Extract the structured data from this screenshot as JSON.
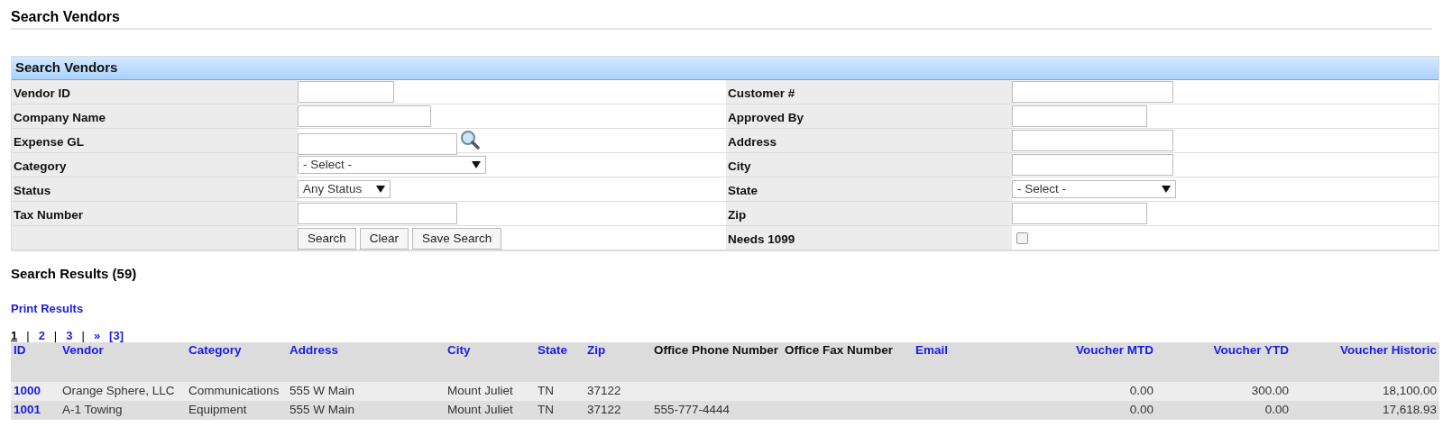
{
  "page_title": "Search Vendors",
  "search_panel": {
    "title": "Search Vendors",
    "left_fields": [
      {
        "label": "Vendor ID",
        "kind": "text"
      },
      {
        "label": "Company Name",
        "kind": "text"
      },
      {
        "label": "Expense GL",
        "kind": "lookup"
      },
      {
        "label": "Category",
        "kind": "select",
        "value": "- Select -"
      },
      {
        "label": "Status",
        "kind": "select",
        "value": "Any Status"
      },
      {
        "label": "Tax Number",
        "kind": "text"
      }
    ],
    "right_fields": [
      {
        "label": "Customer #",
        "kind": "text"
      },
      {
        "label": "Approved By",
        "kind": "text"
      },
      {
        "label": "Address",
        "kind": "text"
      },
      {
        "label": "City",
        "kind": "text"
      },
      {
        "label": "State",
        "kind": "select",
        "value": "- Select -"
      },
      {
        "label": "Zip",
        "kind": "text"
      },
      {
        "label": "Needs 1099",
        "kind": "checkbox",
        "checked": false
      }
    ],
    "buttons": [
      "Search",
      "Clear",
      "Save Search"
    ]
  },
  "results": {
    "title": "Search Results (59)",
    "print_link": "Print Results",
    "pagination": [
      {
        "label": "1",
        "kind": "current"
      },
      {
        "label": "|",
        "kind": "separator"
      },
      {
        "label": "2",
        "kind": "page"
      },
      {
        "label": "|",
        "kind": "separator"
      },
      {
        "label": "3",
        "kind": "page"
      },
      {
        "label": "|",
        "kind": "separator"
      },
      {
        "label": "»",
        "kind": "page"
      },
      {
        "label": "[3]",
        "kind": "page"
      }
    ],
    "columns": [
      {
        "label": "ID",
        "kind": "id",
        "sortable": true
      },
      {
        "label": "Vendor",
        "kind": "text",
        "sortable": true
      },
      {
        "label": "Category",
        "kind": "text",
        "sortable": true
      },
      {
        "label": "Address",
        "kind": "text",
        "sortable": true
      },
      {
        "label": "City",
        "kind": "text",
        "sortable": true
      },
      {
        "label": "State",
        "kind": "text",
        "sortable": true
      },
      {
        "label": "Zip",
        "kind": "text",
        "sortable": true
      },
      {
        "label": "Office Phone Number",
        "kind": "text",
        "sortable": false
      },
      {
        "label": "Office Fax Number",
        "kind": "text",
        "sortable": false
      },
      {
        "label": "Email",
        "kind": "text",
        "sortable": true
      },
      {
        "label": "Voucher MTD",
        "kind": "amount",
        "sortable": true
      },
      {
        "label": "Voucher YTD",
        "kind": "amount",
        "sortable": true
      },
      {
        "label": "Voucher Historic",
        "kind": "amount",
        "sortable": true
      }
    ],
    "rows": [
      [
        "1000",
        "Orange Sphere, LLC",
        "Communications",
        "555 W Main",
        "Mount Juliet",
        "TN",
        "37122",
        "",
        "",
        "",
        "0.00",
        "300.00",
        "18,100.00"
      ],
      [
        "1001",
        "A-1 Towing",
        "Equipment",
        "555 W Main",
        "Mount Juliet",
        "TN",
        "37122",
        "555-777-4444",
        "",
        "",
        "0.00",
        "0.00",
        "17,618.93"
      ]
    ]
  }
}
